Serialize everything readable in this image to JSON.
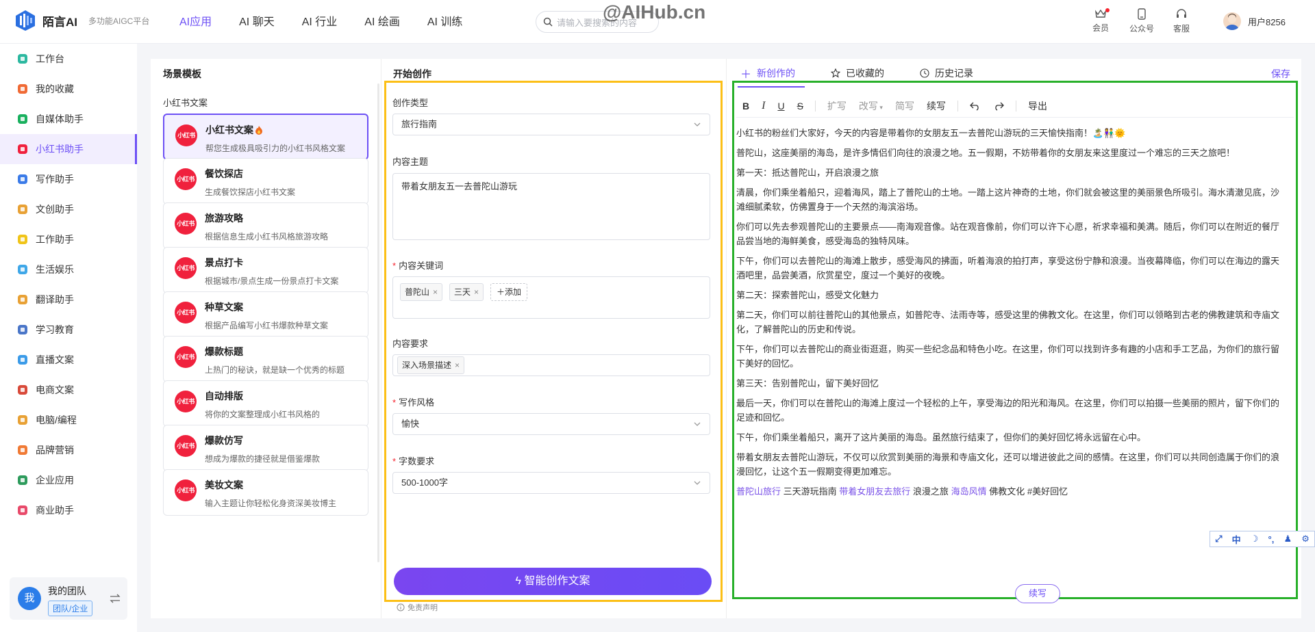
{
  "app": {
    "name": "陌言AI",
    "subtitle": "多功能AIGC平台",
    "watermark": "@AIHub.cn"
  },
  "nav": [
    {
      "label": "AI应用",
      "active": true
    },
    {
      "label": "AI 聊天"
    },
    {
      "label": "AI 行业"
    },
    {
      "label": "AI 绘画"
    },
    {
      "label": "AI 训练"
    }
  ],
  "search": {
    "placeholder": "请输入要搜索的内容"
  },
  "header_tools": [
    {
      "label": "会员",
      "icon": "crown-icon"
    },
    {
      "label": "公众号",
      "icon": "phone-icon"
    },
    {
      "label": "客服",
      "icon": "headset-icon"
    }
  ],
  "user": {
    "name": "用户8256"
  },
  "sidebar": {
    "items": [
      {
        "label": "工作台",
        "icon": "workbench-icon",
        "color": "#2cb8a0"
      },
      {
        "label": "我的收藏",
        "icon": "star-icon",
        "color": "#f06a35"
      },
      {
        "label": "自媒体助手",
        "icon": "check-badge-icon",
        "color": "#19b05e"
      },
      {
        "label": "小红书助手",
        "icon": "xiaohongshu-icon",
        "color": "#f0213d",
        "active": true
      },
      {
        "label": "写作助手",
        "icon": "book-icon",
        "color": "#3b7be8"
      },
      {
        "label": "文创助手",
        "icon": "pen-paper-icon",
        "color": "#e8a135"
      },
      {
        "label": "工作助手",
        "icon": "monitor-icon",
        "color": "#f0c419"
      },
      {
        "label": "生活娱乐",
        "icon": "person-icon",
        "color": "#3fa7e8"
      },
      {
        "label": "翻译助手",
        "icon": "translate-icon",
        "color": "#e8a135"
      },
      {
        "label": "学习教育",
        "icon": "student-icon",
        "color": "#4a76c8"
      },
      {
        "label": "直播文案",
        "icon": "live-icon",
        "color": "#3b9be8"
      },
      {
        "label": "电商文案",
        "icon": "cart-icon",
        "color": "#d84a3a"
      },
      {
        "label": "电脑/编程",
        "icon": "computer-icon",
        "color": "#e8a135"
      },
      {
        "label": "品牌营销",
        "icon": "brand-icon",
        "color": "#f07a35"
      },
      {
        "label": "企业应用",
        "icon": "building-icon",
        "color": "#2e9b5c"
      },
      {
        "label": "商业助手",
        "icon": "heart-hand-icon",
        "color": "#e84a6a"
      }
    ]
  },
  "team": {
    "avatar_text": "我",
    "name": "我的团队",
    "tag": "团队/企业"
  },
  "templates": {
    "title": "场景模板",
    "category": "小红书文案",
    "cards": [
      {
        "icon_text": "小红书",
        "title": "小红书文案",
        "desc": "帮您生成极具吸引力的小红书风格文案",
        "active": true,
        "hot": true
      },
      {
        "icon_text": "小红书",
        "title": "餐饮探店",
        "desc": "生成餐饮探店小红书文案"
      },
      {
        "icon_text": "小红书",
        "title": "旅游攻略",
        "desc": "根据信息生成小红书风格旅游攻略"
      },
      {
        "icon_text": "小红书",
        "title": "景点打卡",
        "desc": "根据城市/景点生成一份景点打卡文案"
      },
      {
        "icon_text": "小红书",
        "title": "种草文案",
        "desc": "根据产品编写小红书爆款种草文案"
      },
      {
        "icon_text": "小红书",
        "title": "爆款标题",
        "desc": "上热门的秘诀，就是缺一个优秀的标题"
      },
      {
        "icon_text": "小红书",
        "title": "自动排版",
        "desc": "将你的文案整理成小红书风格的"
      },
      {
        "icon_text": "小红书",
        "title": "爆款仿写",
        "desc": "想成为爆款的捷径就是借鉴爆款"
      },
      {
        "icon_text": "小红书",
        "title": "美妆文案",
        "desc": "输入主题让你轻松化身资深美妆博主"
      }
    ]
  },
  "form": {
    "title": "开始创作",
    "type_label": "创作类型",
    "type_value": "旅行指南",
    "topic_label": "内容主题",
    "topic_value": "带着女朋友五一去普陀山游玩",
    "keywords_label": "内容关键词",
    "keywords": [
      "普陀山",
      "三天"
    ],
    "add_label": "添加",
    "requirement_label": "内容要求",
    "requirements": [
      "深入场景描述"
    ],
    "style_label": "写作风格",
    "style_value": "愉快",
    "words_label": "字数要求",
    "words_value": "500-1000字",
    "generate_label": "智能创作文案",
    "disclaimer": "免责声明"
  },
  "result": {
    "tabs": [
      {
        "label": "新创作的",
        "icon": "plus-icon",
        "active": true
      },
      {
        "label": "已收藏的",
        "icon": "star-outline-icon"
      },
      {
        "label": "历史记录",
        "icon": "clock-icon"
      }
    ],
    "save_label": "保存",
    "toolbar": {
      "bold": "B",
      "italic": "I",
      "underline": "U",
      "strike": "S",
      "expand": "扩写",
      "rewrite": "改写",
      "simplify": "简写",
      "continue": "续写",
      "export": "导出"
    },
    "paragraphs": [
      "小红书的粉丝们大家好，今天的内容是带着你的女朋友五一去普陀山游玩的三天愉快指南！🏝️👫🌞",
      "普陀山，这座美丽的海岛，是许多情侣们向往的浪漫之地。五一假期，不妨带着你的女朋友来这里度过一个难忘的三天之旅吧！",
      "第一天：抵达普陀山，开启浪漫之旅",
      "清晨，你们乘坐着船只，迎着海风，踏上了普陀山的土地。一踏上这片神奇的土地，你们就会被这里的美丽景色所吸引。海水清澈见底，沙滩细腻柔软，仿佛置身于一个天然的海滨浴场。",
      "你们可以先去参观普陀山的主要景点——南海观音像。站在观音像前，你们可以许下心愿，祈求幸福和美满。随后，你们可以在附近的餐厅品尝当地的海鲜美食，感受海岛的独特风味。",
      "下午，你们可以去普陀山的海滩上散步，感受海风的拂面，听着海浪的拍打声，享受这份宁静和浪漫。当夜幕降临，你们可以在海边的露天酒吧里，品尝美酒，欣赏星空，度过一个美好的夜晚。",
      "第二天：探索普陀山，感受文化魅力",
      "第二天，你们可以前往普陀山的其他景点，如普陀寺、法雨寺等，感受这里的佛教文化。在这里，你们可以领略到古老的佛教建筑和寺庙文化，了解普陀山的历史和传说。",
      "下午，你们可以去普陀山的商业街逛逛，购买一些纪念品和特色小吃。在这里，你们可以找到许多有趣的小店和手工艺品，为你们的旅行留下美好的回忆。",
      "第三天：告别普陀山，留下美好回忆",
      "最后一天，你们可以在普陀山的海滩上度过一个轻松的上午，享受海边的阳光和海风。在这里，你们可以拍摄一些美丽的照片，留下你们的足迹和回忆。",
      "下午，你们乘坐着船只，离开了这片美丽的海岛。虽然旅行结束了，但你们的美好回忆将永远留在心中。",
      "带着女朋友去普陀山游玩，不仅可以欣赏到美丽的海景和寺庙文化，还可以增进彼此之间的感情。在这里，你们可以共同创造属于你们的浪漫回忆，让这个五一假期变得更加难忘。"
    ],
    "keywords": [
      {
        "text": "普陀山旅行",
        "highlight": true
      },
      {
        "text": "三天游玩指南",
        "highlight": false
      },
      {
        "text": "带着女朋友去旅行",
        "highlight": true
      },
      {
        "text": "浪漫之旅",
        "highlight": false
      },
      {
        "text": "海岛风情",
        "highlight": true
      },
      {
        "text": "佛教文化",
        "highlight": false
      },
      {
        "text": "#美好回忆",
        "highlight": false
      }
    ],
    "continue_label": "续写"
  },
  "ime": {
    "lang": "中"
  },
  "colors": {
    "accent": "#6c4ff5",
    "yellow_frame": "#fcbf16",
    "green_frame": "#28b02a",
    "xhs_red": "#f0213d"
  }
}
